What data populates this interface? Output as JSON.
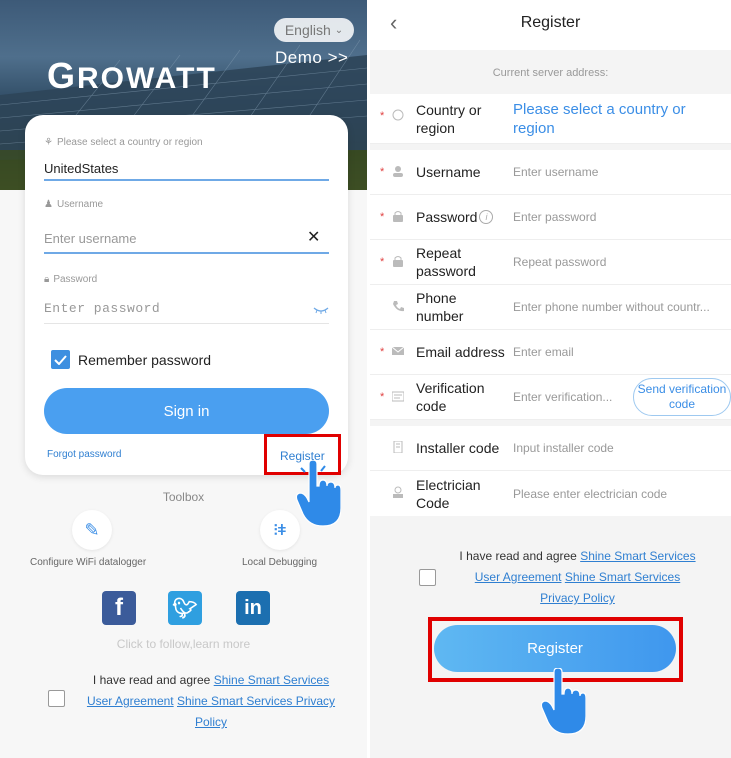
{
  "left": {
    "language": "English",
    "demo_link": "Demo >>",
    "logo": {
      "first": "G",
      "rest": "ROWATT"
    },
    "country_label": "Please select a country or region",
    "country_value": "UnitedStates",
    "username_label": "Username",
    "username_placeholder": "Enter username",
    "password_label": "Password",
    "password_placeholder": "Enter password",
    "remember_label": "Remember password",
    "sign_in": "Sign in",
    "forgot": "Forgot password",
    "register": "Register",
    "toolbox": "Toolbox",
    "tool_wifi": "Configure WiFi datalogger",
    "tool_local": "Local Debugging",
    "follow": "Click to follow,learn more",
    "agree_prefix": "I have read and agree",
    "agree_link1": "Shine Smart Services User Agreement",
    "agree_link2": "Shine Smart Services Privacy Policy"
  },
  "right": {
    "title": "Register",
    "server_label": "Current server address:",
    "rows": [
      {
        "label": "Country or region",
        "value": "Please select a country or region"
      },
      {
        "label": "Username",
        "value": "Enter username"
      },
      {
        "label": "Password",
        "value": "Enter password"
      },
      {
        "label": "Repeat password",
        "value": "Repeat password"
      },
      {
        "label": "Phone number",
        "value": "Enter phone number without countr..."
      },
      {
        "label": "Email address",
        "value": "Enter email"
      },
      {
        "label": "Verification code",
        "value": "Enter verification...",
        "button": "Send verification code"
      },
      {
        "label": "Installer code",
        "value": "Input installer code"
      },
      {
        "label": "Electrician Code",
        "value": "Please enter electrician code"
      }
    ],
    "agree_prefix": "I have read and agree",
    "agree_link1": "Shine Smart Services User Agreement",
    "agree_link2": "Shine Smart Services Privacy Policy",
    "register_button": "Register"
  },
  "colors": {
    "accent": "#4a9ff0",
    "highlight": "#e00000",
    "link": "#2f7fd1",
    "required": "#e04040"
  }
}
